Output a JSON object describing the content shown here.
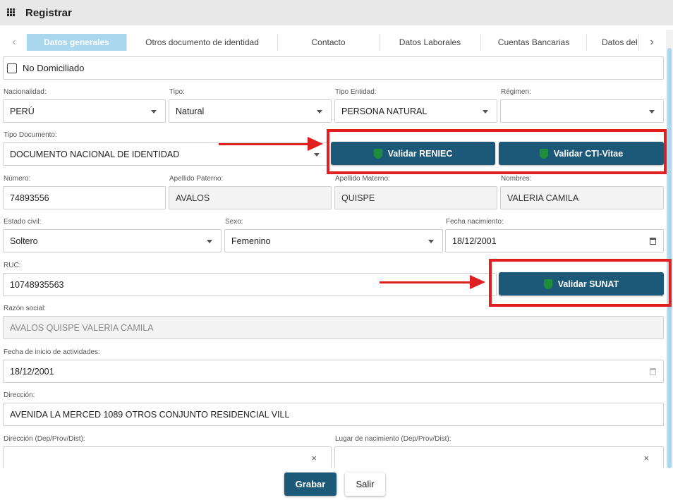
{
  "header": {
    "title": "Registrar",
    "menu_icon": "grid-icon"
  },
  "tabs": [
    {
      "label": "Datos generales",
      "active": true
    },
    {
      "label": "Otros documento de identidad",
      "active": false
    },
    {
      "label": "Contacto",
      "active": false
    },
    {
      "label": "Datos Laborales",
      "active": false
    },
    {
      "label": "Cuentas Bancarias",
      "active": false
    },
    {
      "label": "Datos del",
      "active": false
    }
  ],
  "no_domiciliado": {
    "label": "No Domiciliado",
    "checked": false
  },
  "nacionalidad": {
    "label": "Nacionalidad:",
    "value": "PERÚ"
  },
  "tipo": {
    "label": "Tipo:",
    "value": "Natural"
  },
  "tipo_entidad": {
    "label": "Tipo Entidad:",
    "value": "PERSONA NATURAL"
  },
  "regimen": {
    "label": "Régimen:",
    "value": ""
  },
  "tipo_documento": {
    "label": "Tipo Documento:",
    "value": "DOCUMENTO NACIONAL DE IDENTIDAD"
  },
  "buttons": {
    "validar_reniec": "Validar RENIEC",
    "validar_cti": "Validar CTI-Vitae",
    "validar_sunat": "Validar SUNAT"
  },
  "numero": {
    "label": "Número:",
    "value": "74893556"
  },
  "apellido_paterno": {
    "label": "Apellido Paterno:",
    "value": "AVALOS"
  },
  "apellido_materno": {
    "label": "Apellido Materno:",
    "value": "QUISPE"
  },
  "nombres": {
    "label": "Nombres:",
    "value": "VALERIA CAMILA"
  },
  "estado_civil": {
    "label": "Estado civil:",
    "value": "Soltero"
  },
  "sexo": {
    "label": "Sexo:",
    "value": "Femenino"
  },
  "fecha_nacimiento": {
    "label": "Fecha nacimiento:",
    "value": "18/12/2001"
  },
  "ruc": {
    "label": "RUC:",
    "value": "10748935563"
  },
  "razon_social": {
    "label": "Razón social:",
    "value": "AVALOS QUISPE VALERIA CAMILA"
  },
  "fecha_inicio": {
    "label": "Fecha de inicio de actividades:",
    "value": "18/12/2001"
  },
  "direccion": {
    "label": "Dirección:",
    "value": "AVENIDA LA MERCED 1089 OTROS CONJUNTO RESIDENCIAL VILL"
  },
  "direccion_ubigeo": {
    "label": "Dirección (Dep/Prov/Dist):",
    "value": ""
  },
  "lugar_nacimiento": {
    "label": "Lugar de nacimiento (Dep/Prov/Dist):",
    "value": ""
  },
  "footer": {
    "grabar": "Grabar",
    "salir": "Salir"
  },
  "colors": {
    "primary": "#1c5877",
    "tab_active": "#a8d7ee",
    "annotation_red": "#e02020",
    "shield_green": "#1f8d3c"
  }
}
